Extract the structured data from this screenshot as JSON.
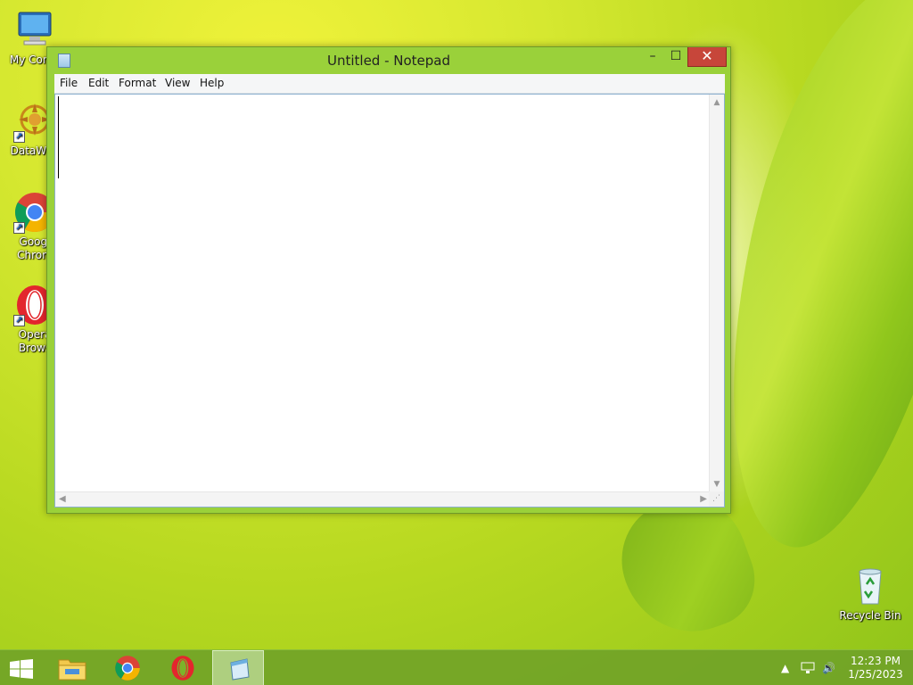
{
  "desktop": {
    "icons": [
      {
        "label": "My Comp",
        "icon": "computer-icon"
      },
      {
        "label": "DataWag",
        "icon": "datawagon-icon"
      },
      {
        "label": "Googl\nChrom",
        "icon": "chrome-icon"
      },
      {
        "label": "Opera\nBrows",
        "icon": "opera-icon"
      }
    ],
    "recycle_bin": {
      "label": "Recycle Bin",
      "icon": "recycle-bin-icon"
    }
  },
  "window": {
    "title": "Untitled - Notepad",
    "controls": {
      "minimize": "–",
      "maximize": "☐",
      "close": "✕"
    },
    "menu": [
      "File",
      "Edit",
      "Format",
      "View",
      "Help"
    ],
    "content": ""
  },
  "taskbar": {
    "items": [
      "start-button",
      "file-explorer",
      "google-chrome",
      "opera",
      "notepad"
    ],
    "tray": {
      "time": "12:23 PM",
      "date": "1/25/2023"
    }
  },
  "colors": {
    "taskbar": "#6ea028",
    "window_frame": "#9ad13a",
    "close_button": "#c7463a"
  }
}
